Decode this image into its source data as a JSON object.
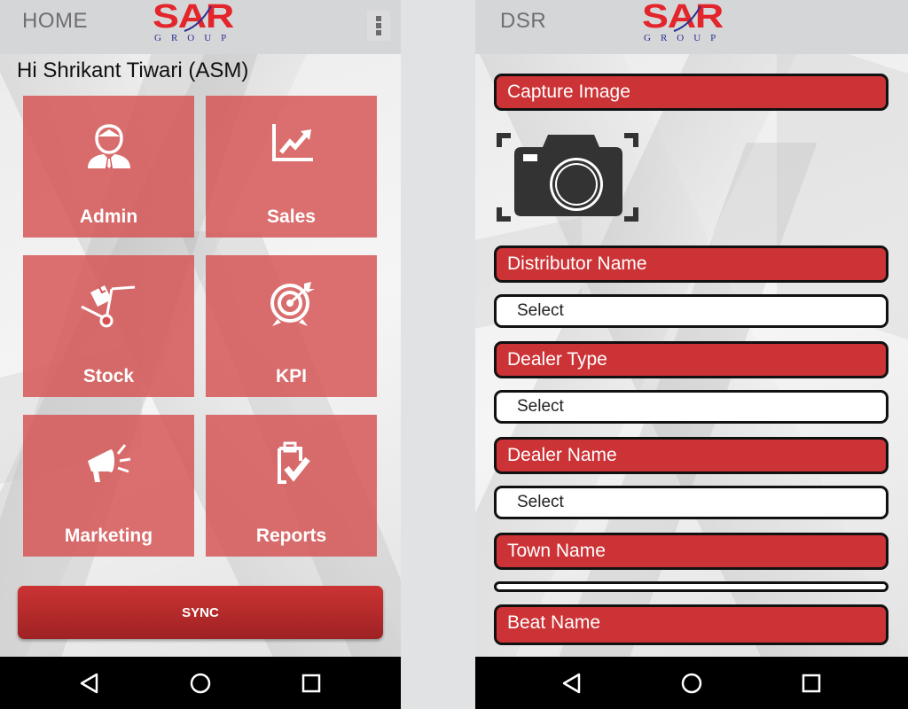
{
  "colors": {
    "brand_red": "#e3252c",
    "brand_blue": "#2a2f8f",
    "tile_red": "#d65050",
    "field_red": "#cc3336",
    "appbar_gray": "#d5d6d8",
    "navbar": "#000000"
  },
  "logo": {
    "name": "SAR",
    "subtitle": "GROUP"
  },
  "home_screen": {
    "appbar": {
      "title": "HOME",
      "overflow_icon": "more-vert-icon"
    },
    "greeting": "Hi Shrikant Tiwari (ASM)",
    "tiles": [
      {
        "label": "Admin",
        "icon": "user-tie-icon"
      },
      {
        "label": "Sales",
        "icon": "trending-up-chart-icon"
      },
      {
        "label": "Stock",
        "icon": "hand-truck-box-icon"
      },
      {
        "label": "KPI",
        "icon": "target-arrow-icon"
      },
      {
        "label": "Marketing",
        "icon": "megaphone-icon"
      },
      {
        "label": "Reports",
        "icon": "clipboard-check-icon"
      }
    ],
    "sync_button": "SYNC"
  },
  "dsr_screen": {
    "appbar": {
      "title": "DSR"
    },
    "capture_image_label": "Capture Image",
    "camera_icon": "camera-icon",
    "fields": [
      {
        "label": "Distributor Name",
        "value": "Select",
        "type": "select"
      },
      {
        "label": "Dealer Type",
        "value": "Select",
        "type": "select"
      },
      {
        "label": "Dealer Name",
        "value": "Select",
        "type": "select"
      },
      {
        "label": "Town Name",
        "value": "",
        "type": "text"
      },
      {
        "label": "Beat Name"
      }
    ]
  },
  "navigation_bar": {
    "back": "back-icon",
    "home": "home-icon",
    "recents": "recents-icon"
  }
}
